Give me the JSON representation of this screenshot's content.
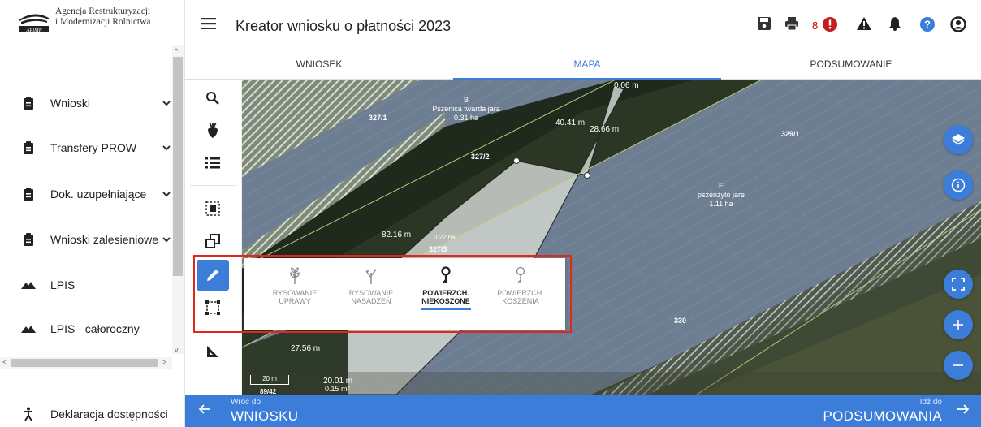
{
  "org": {
    "name_line1": "Agencja Restrukturyzacji",
    "name_line2": "i Modernizacji Rolnictwa",
    "logo_text": "ARiMR"
  },
  "sidebar": {
    "items": [
      {
        "label": "Wnioski",
        "icon": "clipboard-icon",
        "has_chevron": true
      },
      {
        "label": "Transfery PROW",
        "icon": "clipboard-icon",
        "has_chevron": true
      },
      {
        "label": "Dok. uzupełniające",
        "icon": "clipboard-icon",
        "has_chevron": true
      },
      {
        "label": "Wnioski zalesieniowe",
        "icon": "clipboard-icon",
        "has_chevron": true
      },
      {
        "label": "LPIS",
        "icon": "terrain-icon",
        "has_chevron": false
      },
      {
        "label": "LPIS - całoroczny",
        "icon": "terrain-icon",
        "has_chevron": false
      }
    ],
    "accessibility_label": "Deklaracja dostępności"
  },
  "header": {
    "title": "Kreator wniosku o płatności 2023",
    "notification_count": "8"
  },
  "tabs": [
    {
      "label": "WNIOSEK",
      "active": false
    },
    {
      "label": "MAPA",
      "active": true
    },
    {
      "label": "PODSUMOWANIE",
      "active": false
    }
  ],
  "map": {
    "parcel_labels": [
      "327/1",
      "327/2",
      "327/3",
      "329/1",
      "330",
      "89/42"
    ],
    "crop_b": {
      "letter": "B",
      "name": "Pszenica twarda jara",
      "area": "0.31 ha"
    },
    "crop_e": {
      "letter": "E",
      "name": "pszenżyto jare",
      "area": "1.11 ha"
    },
    "measurements": [
      "0.06 m",
      "40.41 m",
      "28.66 m",
      "82.16 m",
      "0.22 ha",
      "27.56 m",
      "20.01 m",
      "0.15 m²"
    ],
    "scale": "20 m"
  },
  "draw_popup": {
    "options": [
      {
        "line1": "RYSOWANIE",
        "line2": "UPRAWY",
        "icon": "seedling-icon",
        "selected": false
      },
      {
        "line1": "RYSOWANIE",
        "line2": "NASADZEŃ",
        "icon": "sprout-icon",
        "selected": false
      },
      {
        "line1": "POWIERZCH.",
        "line2": "NIEKOSZONE",
        "icon": "pin-icon",
        "selected": true
      },
      {
        "line1": "POWIERZCH.",
        "line2": "KOSZENIA",
        "icon": "pin-outline-icon",
        "selected": false
      }
    ]
  },
  "footer": {
    "back_small": "Wróć do",
    "back_big": "WNIOSKU",
    "fwd_small": "Idź do",
    "fwd_big": "PODSUMOWANIA"
  },
  "colors": {
    "accent": "#3b7dd8",
    "alert": "#e1261c"
  }
}
